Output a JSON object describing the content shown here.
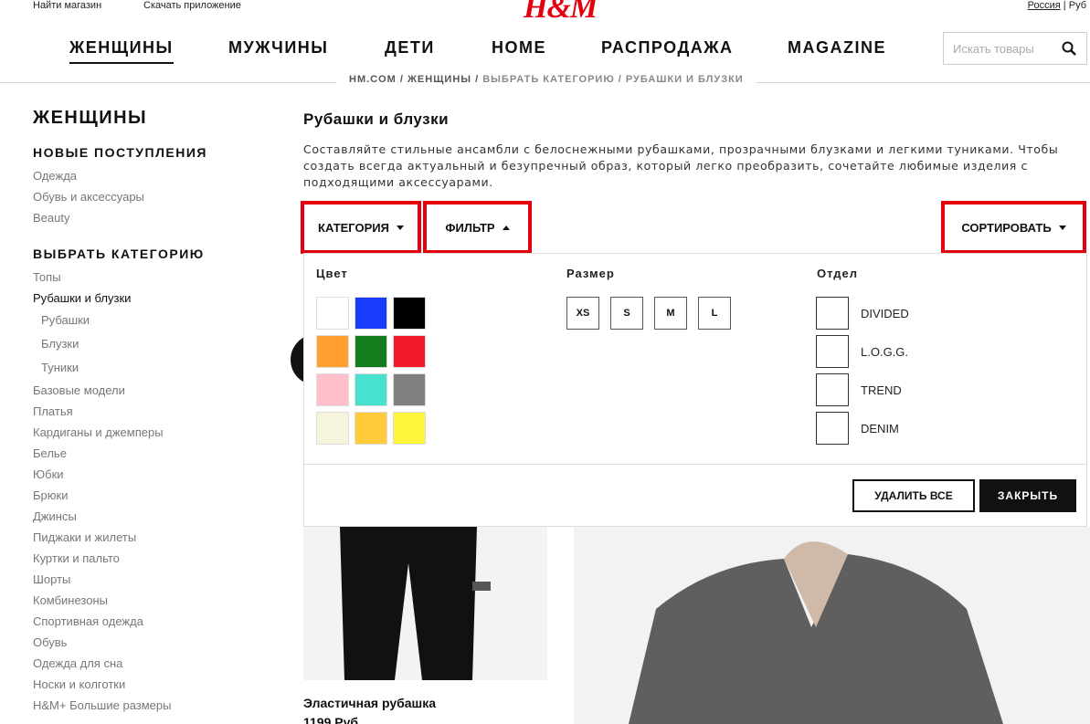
{
  "header": {
    "find_store": "Найти магазин",
    "download_app": "Скачать приложение",
    "logo": "H&M",
    "country": "Россия",
    "currency": "Руб",
    "region_sep": " | "
  },
  "nav": [
    "ЖЕНЩИНЫ",
    "МУЖЧИНЫ",
    "ДЕТИ",
    "HOME",
    "РАСПРОДАЖА",
    "MAGAZINE"
  ],
  "search": {
    "placeholder": "Искать товары"
  },
  "breadcrumb": {
    "path": "HM.COM / ЖЕНЩИНЫ / ",
    "current": "ВЫБРАТЬ КАТЕГОРИЮ / РУБАШКИ И БЛУЗКИ"
  },
  "sidebar": {
    "title": "ЖЕНЩИНЫ",
    "new_heading": "НОВЫЕ ПОСТУПЛЕНИЯ",
    "new_items": [
      "Одежда",
      "Обувь и аксессуары",
      "Beauty"
    ],
    "cat_heading": "ВЫБРАТЬ КАТЕГОРИЮ",
    "cat_items": [
      "Топы",
      "Рубашки и блузки",
      "Рубашки",
      "Блузки",
      "Туники",
      "Базовые модели",
      "Платья",
      "Кардиганы и джемперы",
      "Белье",
      "Юбки",
      "Брюки",
      "Джинсы",
      "Пиджаки и жилеты",
      "Куртки и пальто",
      "Шорты",
      "Комбинезоны",
      "Спортивная одежда",
      "Обувь",
      "Одежда для сна",
      "Носки и колготки",
      "H&M+ Большие размеры"
    ]
  },
  "main": {
    "title": "Рубашки и блузки",
    "description": "Составляйте стильные ансамбли с белоснежными рубашками, прозрачными блузками и легкими туниками. Чтобы создать всегда актуальный и безупречный образ, который легко преобразить, сочетайте любимые изделия с подходящими аксессуарами."
  },
  "toolbar": {
    "category": "КАТЕГОРИЯ",
    "filter": "ФИЛЬТР",
    "sort": "СОРТИРОВАТЬ"
  },
  "filter_panel": {
    "color_label": "Цвет",
    "size_label": "Размер",
    "dept_label": "Отдел",
    "colors": [
      "#ffffff",
      "#1a3cff",
      "#000000",
      "#ffa030",
      "#137d1e",
      "#f21a2a",
      "#ffc0cb",
      "#48e0cf",
      "#808080",
      "#f6f4dd",
      "#ffcb3a",
      "#fff53a"
    ],
    "sizes": [
      "XS",
      "S",
      "M",
      "L"
    ],
    "departments": [
      "DIVIDED",
      "L.O.G.G.",
      "TREND",
      "DENIM"
    ],
    "clear_all": "УДАЛИТЬ ВСЕ",
    "close": "ЗАКРЫТЬ"
  },
  "product": {
    "name": "Эластичная рубашка",
    "price": "1199 Руб."
  }
}
